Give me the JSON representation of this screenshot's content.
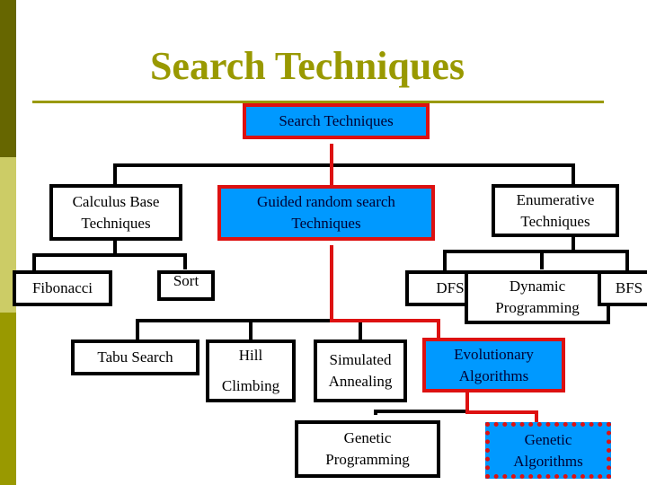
{
  "slide": {
    "title": "Search Techniques",
    "accent_color": "#999900",
    "highlight_fill": "#0099ff",
    "highlight_border": "#dd1111"
  },
  "tree": {
    "root": {
      "label": "Search Techniques",
      "highlighted": true
    },
    "calculus": {
      "line1": "Calculus Base",
      "line2": "Techniques"
    },
    "fibonacci": {
      "label": "Fibonacci"
    },
    "sort": {
      "label": "Sort"
    },
    "guided": {
      "line1": "Guided random search",
      "line2": "Techniques",
      "highlighted": true
    },
    "enumerative": {
      "line1": "Enumerative",
      "line2": "Techniques"
    },
    "dfs": {
      "label": "DFS"
    },
    "dynamic": {
      "line1": "Dynamic",
      "line2": "Programming"
    },
    "bfs": {
      "label": "BFS"
    },
    "tabu": {
      "label": "Tabu Search"
    },
    "hill": {
      "line1": "Hill",
      "line2": "Climbing"
    },
    "annealing": {
      "line1": "Simulated",
      "line2": "Annealing"
    },
    "evolutionary": {
      "line1": "Evolutionary",
      "line2": "Algorithms",
      "highlighted": true
    },
    "genetic_programming": {
      "line1": "Genetic",
      "line2": "Programming"
    },
    "genetic_algorithms": {
      "line1": "Genetic",
      "line2": "Algorithms",
      "highlighted": true,
      "selected": true
    }
  }
}
